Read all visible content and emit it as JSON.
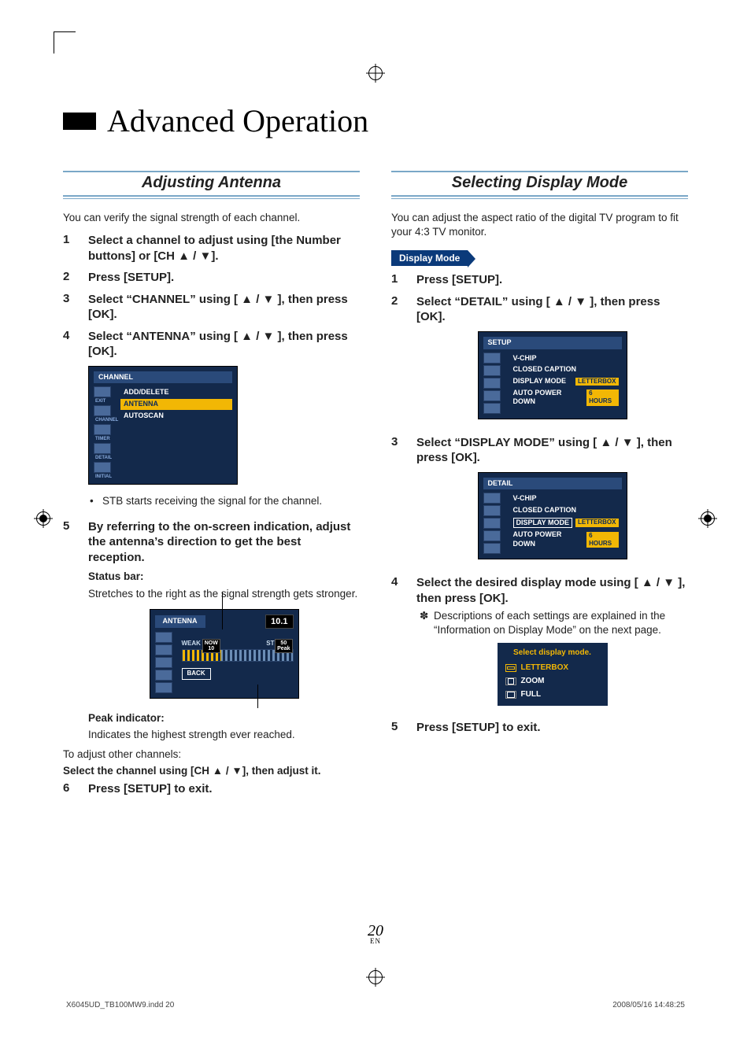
{
  "page_title": "Advanced Operation",
  "left": {
    "section_title": "Adjusting Antenna",
    "intro": "You can verify the signal strength of each channel.",
    "steps": {
      "s1": "Select a channel to adjust using [the Number buttons] or [CH ▲ / ▼].",
      "s2": "Press [SETUP].",
      "s3": "Select “CHANNEL” using [ ▲ / ▼ ], then press [OK].",
      "s4": "Select “ANTENNA” using [ ▲ / ▼ ], then press [OK].",
      "s4_bullet": "STB starts receiving the signal for the channel.",
      "s5": "By referring to the on-screen indication, adjust the antenna’s direction to get the best reception.",
      "status_bar_label": "Status bar:",
      "status_bar_text": "Stretches to the right as the signal strength gets stronger.",
      "peak_label": "Peak indicator:",
      "peak_text": "Indicates the highest strength ever reached.",
      "adjust_other": "To adjust other channels:",
      "adjust_other_bold": "Select the channel using [CH ▲ / ▼], then adjust it.",
      "s6": "Press [SETUP] to exit."
    },
    "osd_channel": {
      "title": "CHANNEL",
      "side_labels": [
        "EXIT",
        "CHANNEL",
        "TIMER",
        "DETAIL",
        "INITIAL"
      ],
      "items": {
        "add": "ADD/DELETE",
        "antenna": "ANTENNA",
        "autoscan": "AUTOSCAN"
      }
    },
    "osd_antenna": {
      "title": "ANTENNA",
      "channel_display": "10.1",
      "weak": "WEAK",
      "strong": "STRONG",
      "now_label": "NOW",
      "now_val": "10",
      "peak_label": "Peak",
      "peak_val": "50",
      "back": "BACK"
    }
  },
  "right": {
    "section_title": "Selecting Display Mode",
    "intro": "You can adjust the aspect ratio of the digital TV program to fit your 4:3 TV monitor.",
    "display_mode_label": "Display Mode",
    "steps": {
      "s1": "Press [SETUP].",
      "s2": "Select “DETAIL” using [ ▲ / ▼ ], then press [OK].",
      "s3": "Select “DISPLAY MODE” using [ ▲ / ▼ ], then press [OK].",
      "s4": "Select the desired display mode using [ ▲ / ▼ ], then press [OK].",
      "s4_note": "Descriptions of each settings are explained in the “Information on Display Mode” on the next page.",
      "s5": "Press [SETUP] to exit."
    },
    "osd_setup": {
      "title": "SETUP",
      "items": {
        "vchip": "V-CHIP",
        "cc": "CLOSED CAPTION",
        "display": "DISPLAY MODE",
        "display_val": "LETTERBOX",
        "apd": "AUTO POWER DOWN",
        "apd_val": "6 HOURS"
      }
    },
    "osd_detail": {
      "title": "DETAIL",
      "items": {
        "vchip": "V-CHIP",
        "cc": "CLOSED CAPTION",
        "display": "DISPLAY MODE",
        "display_val": "LETTERBOX",
        "apd": "AUTO POWER DOWN",
        "apd_val": "6 HOURS"
      }
    },
    "osd_select": {
      "header": "Select display mode.",
      "opt1": "LETTERBOX",
      "opt2": "ZOOM",
      "opt3": "FULL"
    }
  },
  "page_number": "20",
  "page_number_sub": "EN",
  "footer_left": "X6045UD_TB100MW9.indd   20",
  "footer_right": "2008/05/16   14:48:25"
}
